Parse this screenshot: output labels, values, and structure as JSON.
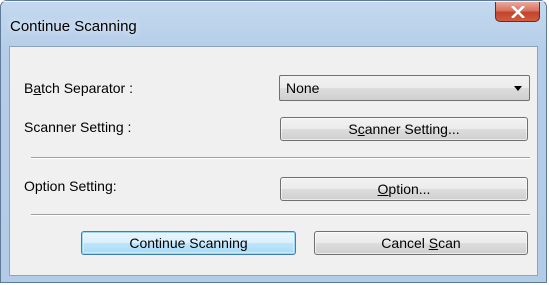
{
  "window": {
    "title": "Continue Scanning"
  },
  "batch_separator": {
    "label_pre": "B",
    "label_mnemonic": "a",
    "label_post": "tch Separator :",
    "selected": "None"
  },
  "scanner_setting": {
    "label": "Scanner Setting :",
    "button_pre": "S",
    "button_mnemonic": "c",
    "button_post": "anner Setting..."
  },
  "option_setting": {
    "label": "Option Setting:",
    "button_mnemonic": "O",
    "button_post": "ption..."
  },
  "footer": {
    "continue_label": "Continue Scanning",
    "cancel_pre": "Cancel ",
    "cancel_mnemonic": "S",
    "cancel_post": "can"
  },
  "colors": {
    "title_bar": "#b9d1ea",
    "close_button": "#c7503a",
    "dialog_body": "#f0f0f0",
    "default_button_border": "#3c7fb1"
  },
  "icons": {
    "close": "close-icon",
    "dropdown": "chevron-down-icon"
  }
}
